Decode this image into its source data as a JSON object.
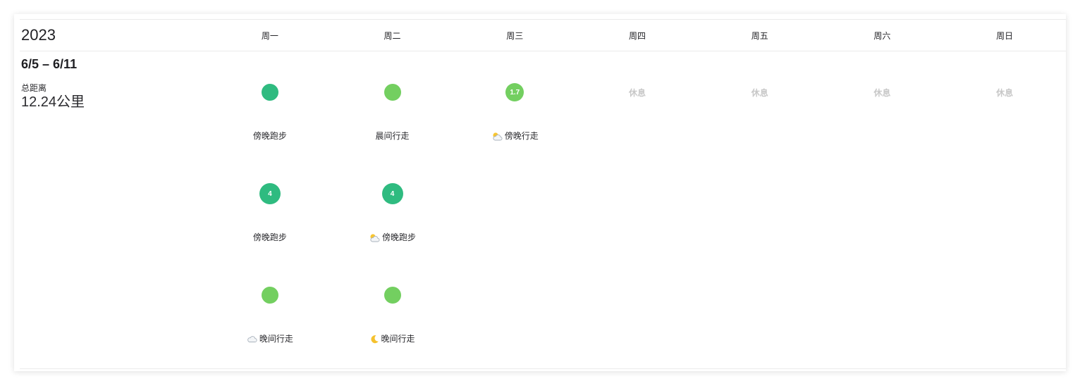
{
  "year": "2023",
  "weekdays": [
    "周一",
    "周二",
    "周三",
    "周四",
    "周五",
    "周六",
    "周日"
  ],
  "week": {
    "range": "6/5 – 6/11",
    "total_distance_label": "总距离",
    "total_distance_value": "12.24公里"
  },
  "days": [
    {
      "activities": [
        {
          "color": "#2fbb80",
          "label": "傍晚跑步"
        },
        {
          "color": "#2fbb80",
          "badge": "4",
          "label": "傍晚跑步"
        },
        {
          "color": "#73cf60",
          "icon": "cloud-icon",
          "label": "晚间行走"
        }
      ]
    },
    {
      "activities": [
        {
          "color": "#73cf60",
          "label": "晨间行走"
        },
        {
          "color": "#2fbb80",
          "badge": "4",
          "icon": "partly-cloudy-icon",
          "label": "傍晚跑步"
        },
        {
          "color": "#73cf60",
          "icon": "moon-icon",
          "label": "晚间行走"
        }
      ]
    },
    {
      "activities": [
        {
          "color": "#73cf60",
          "badge": "1.7",
          "icon": "partly-cloudy-icon",
          "label": "傍晚行走"
        }
      ]
    },
    {
      "rest_label": "休息"
    },
    {
      "rest_label": "休息"
    },
    {
      "rest_label": "休息"
    },
    {
      "rest_label": "休息"
    }
  ]
}
